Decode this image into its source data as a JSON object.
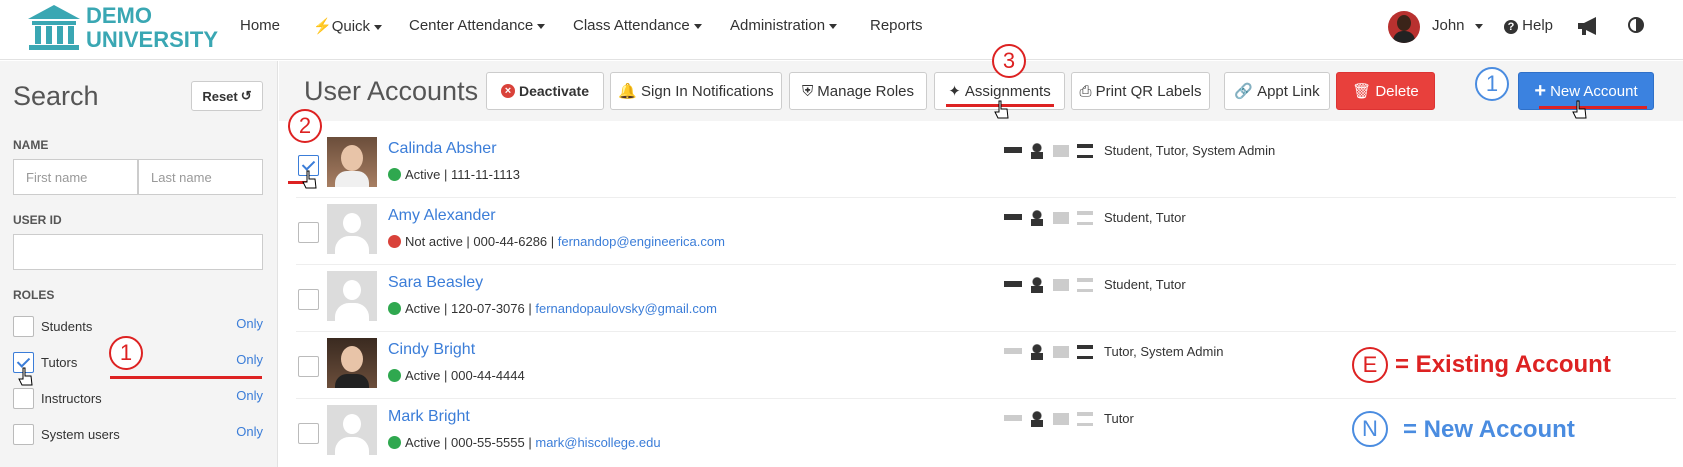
{
  "header": {
    "logo_line1": "DEMO",
    "logo_line2": "UNIVERSITY",
    "nav": [
      "Home",
      "Quick",
      "Center Attendance",
      "Class Attendance",
      "Administration",
      "Reports"
    ],
    "user_name": "John",
    "help_label": "Help"
  },
  "sidebar": {
    "title": "Search",
    "reset_label": "Reset",
    "name_label": "NAME",
    "first_name_placeholder": "First name",
    "last_name_placeholder": "Last name",
    "user_id_label": "USER ID",
    "roles_label": "ROLES",
    "roles": [
      {
        "label": "Students",
        "checked": false,
        "only": "Only"
      },
      {
        "label": "Tutors",
        "checked": true,
        "only": "Only"
      },
      {
        "label": "Instructors",
        "checked": false,
        "only": "Only"
      },
      {
        "label": "System users",
        "checked": false,
        "only": "Only"
      }
    ]
  },
  "toolbar": {
    "title": "User Accounts",
    "deactivate": "Deactivate",
    "sign_in_notifications": "Sign In Notifications",
    "manage_roles": "Manage Roles",
    "assignments": "Assignments",
    "print_qr": "Print QR Labels",
    "appt_link": "Appt Link",
    "delete": "Delete",
    "new_account": "New Account"
  },
  "users": [
    {
      "name": "Calinda Absher",
      "status": "Active",
      "id": "111-11-1113",
      "email": "",
      "roles": "Student, Tutor, System Admin",
      "checked": true,
      "photo": true
    },
    {
      "name": "Amy Alexander",
      "status": "Not active",
      "id": "000-44-6286",
      "email": "fernandop@engineerica.com",
      "roles": "Student, Tutor",
      "checked": false,
      "photo": false
    },
    {
      "name": "Sara Beasley",
      "status": "Active",
      "id": "120-07-3076",
      "email": "fernandopaulovsky@gmail.com",
      "roles": "Student, Tutor",
      "checked": false,
      "photo": false
    },
    {
      "name": "Cindy Bright",
      "status": "Active",
      "id": "000-44-4444",
      "email": "",
      "roles": "Tutor, System Admin",
      "checked": false,
      "photo": true
    },
    {
      "name": "Mark Bright",
      "status": "Active",
      "id": "000-55-5555",
      "email": "mark@hiscollege.edu",
      "roles": "Tutor",
      "checked": false,
      "photo": false
    }
  ],
  "annotations": {
    "n1": "1",
    "n2": "2",
    "n3": "3",
    "legend_e_letter": "E",
    "legend_e_text": "= Existing Account",
    "legend_n_letter": "N",
    "legend_n_text": "= New Account"
  },
  "colors": {
    "accent": "#3b7dd8",
    "danger": "#e8403c",
    "annotation": "#dd2222",
    "logo": "#3aa7b3"
  }
}
